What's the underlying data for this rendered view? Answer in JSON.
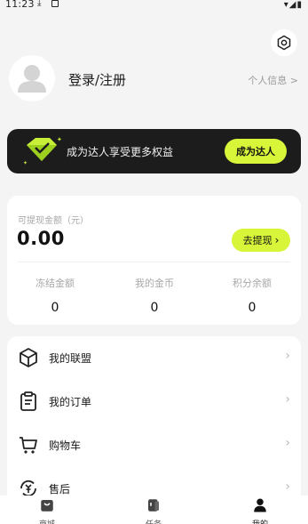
{
  "status_bar": {
    "time": "11:23"
  },
  "profile": {
    "login_label": "登录/注册",
    "personal_info_label": "个人信息 >"
  },
  "vip_banner": {
    "text": "成为达人享受更多权益",
    "button_label": "成为达人"
  },
  "wallet": {
    "label": "可提现金额（元）",
    "amount": "0.00",
    "withdraw_label": "去提现",
    "stats": [
      {
        "label": "冻结金额",
        "value": "0"
      },
      {
        "label": "我的金币",
        "value": "0"
      },
      {
        "label": "积分余额",
        "value": "0"
      }
    ]
  },
  "menu": [
    {
      "label": "我的联盟",
      "icon": "cube-icon"
    },
    {
      "label": "我的订单",
      "icon": "clipboard-icon"
    },
    {
      "label": "购物车",
      "icon": "cart-icon"
    },
    {
      "label": "售后",
      "icon": "yuan-refresh-icon"
    }
  ],
  "tabbar": {
    "tabs": [
      {
        "label": "商城",
        "icon": "shop-icon",
        "active": false
      },
      {
        "label": "任务",
        "icon": "task-icon",
        "active": false
      },
      {
        "label": "我的",
        "icon": "user-icon",
        "active": true
      }
    ]
  },
  "colors": {
    "accent": "#d8f53a",
    "banner_bg": "#1c1c1c",
    "page_bg": "#f4f4f4"
  }
}
